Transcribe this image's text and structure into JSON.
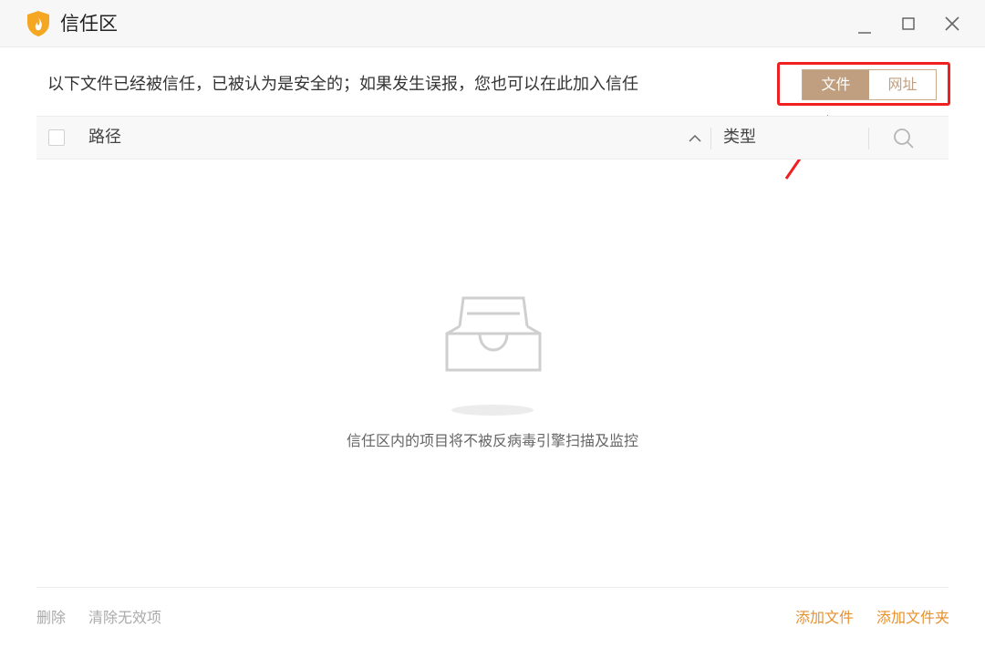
{
  "window": {
    "title": "信任区",
    "controls": [
      "minimize",
      "maximize",
      "close"
    ]
  },
  "description": "以下文件已经被信任，已被认为是安全的；如果发生误报，您也可以在此加入信任",
  "segment": {
    "options": [
      {
        "label": "文件",
        "selected": true
      },
      {
        "label": "网址",
        "selected": false
      }
    ]
  },
  "table": {
    "columns": {
      "path": "路径",
      "type": "类型"
    },
    "rows": []
  },
  "empty_state": {
    "message": "信任区内的项目将不被反病毒引擎扫描及监控"
  },
  "footer": {
    "delete_label": "删除",
    "clear_invalid_label": "清除无效项",
    "add_file_label": "添加文件",
    "add_folder_label": "添加文件夹"
  },
  "colors": {
    "accent": "#bf9f7f",
    "link": "#e8902c",
    "annotation": "#f02020",
    "logo": "#f5a623"
  },
  "icons": {
    "logo": "shield-flame-icon",
    "sort": "chevron-up-icon",
    "search": "search-icon",
    "empty": "empty-tray-icon"
  }
}
